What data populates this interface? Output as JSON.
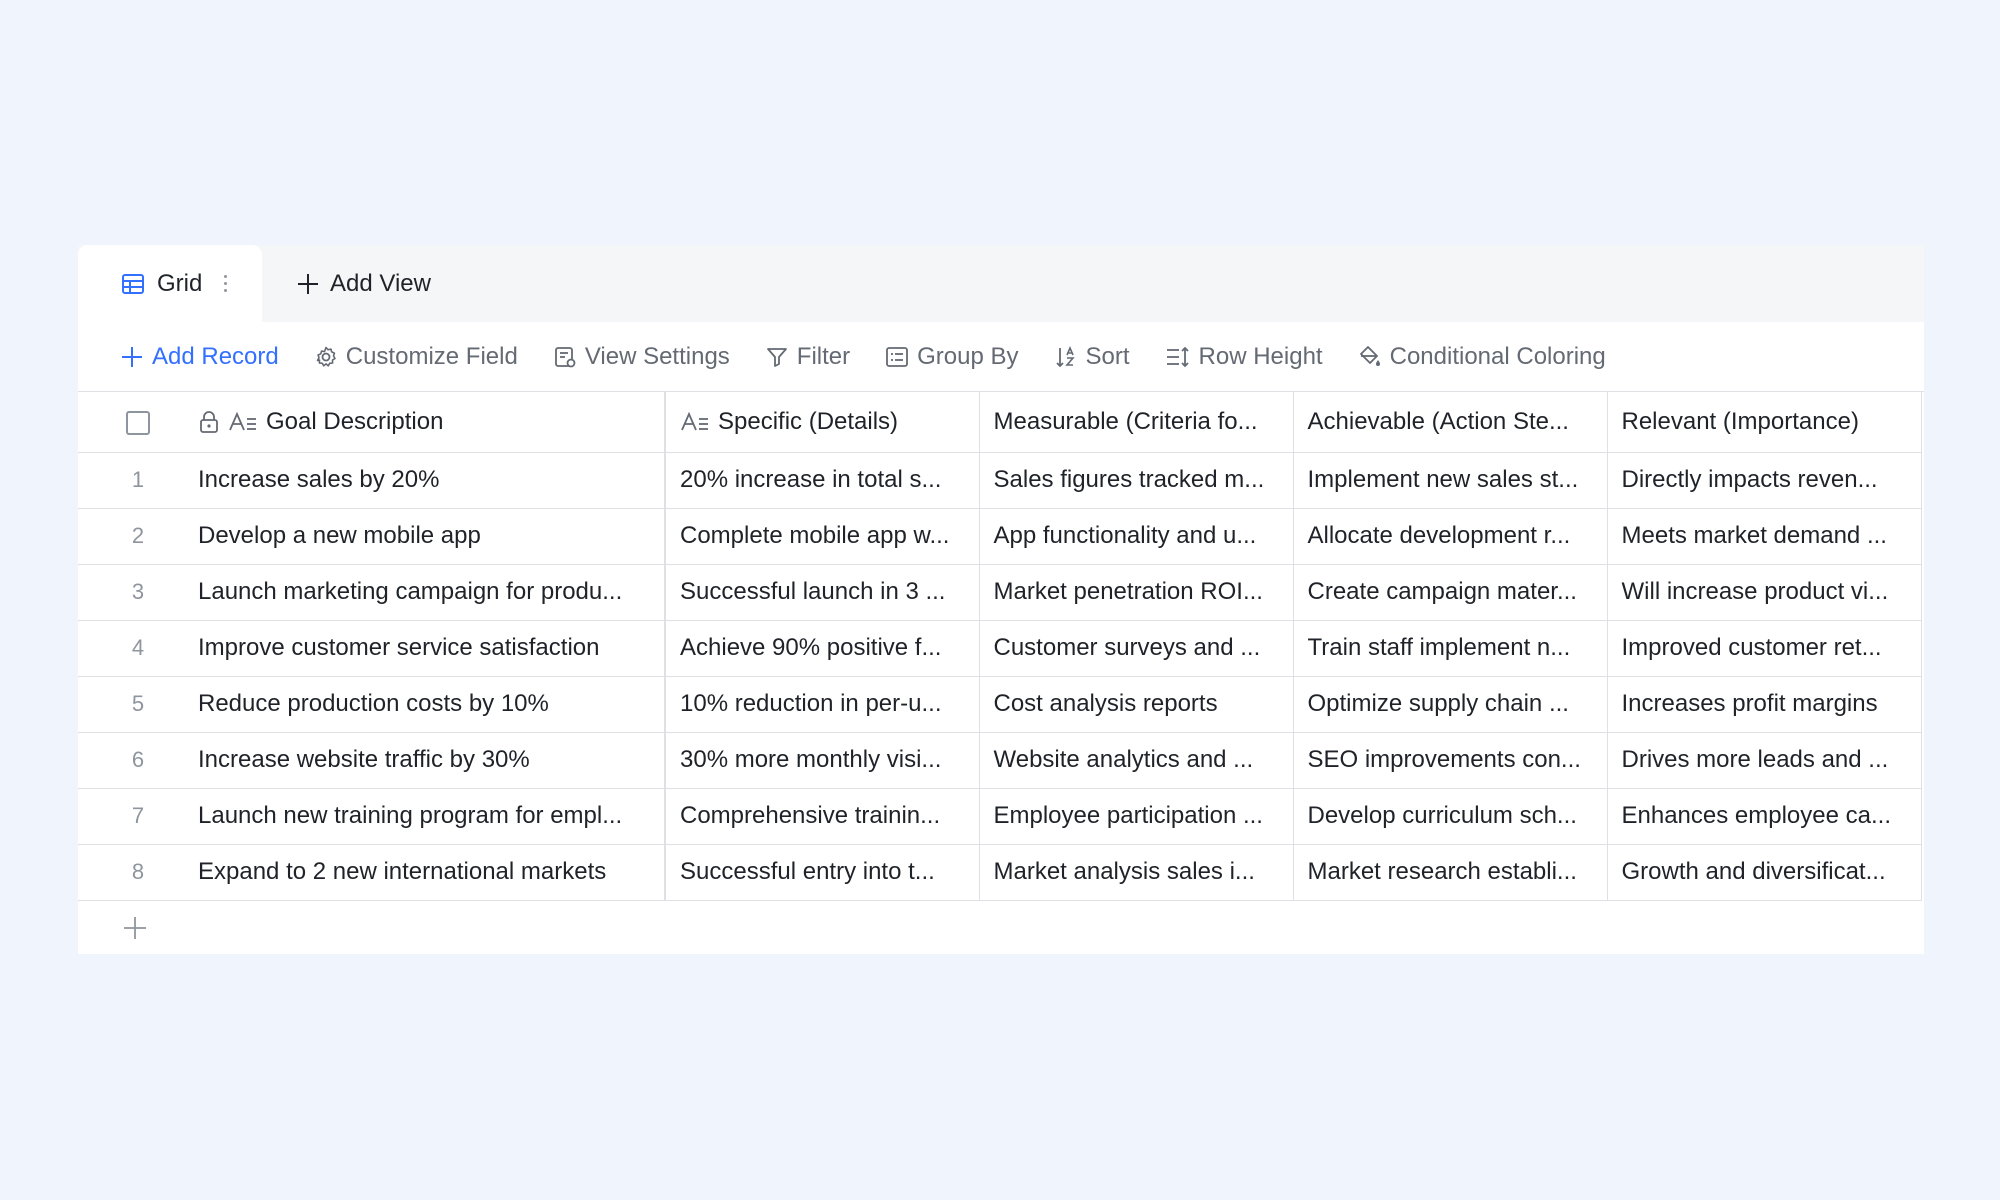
{
  "tabs": {
    "grid_label": "Grid",
    "add_view_label": "Add View"
  },
  "toolbar": {
    "add_record": "Add Record",
    "customize_field": "Customize Field",
    "view_settings": "View Settings",
    "filter": "Filter",
    "group_by": "Group By",
    "sort": "Sort",
    "row_height": "Row Height",
    "conditional_coloring": "Conditional Coloring"
  },
  "columns": [
    "Goal Description",
    "Specific (Details)",
    "Measurable (Criteria fo...",
    "Achievable (Action Ste...",
    "Relevant (Importance)"
  ],
  "rows": [
    {
      "n": "1",
      "cells": [
        "Increase sales by 20%",
        "20% increase in total s...",
        "Sales figures tracked m...",
        "Implement new sales st...",
        "Directly impacts reven..."
      ]
    },
    {
      "n": "2",
      "cells": [
        "Develop a new mobile app",
        "Complete mobile app w...",
        "App functionality and u...",
        "Allocate development r...",
        "Meets market demand ..."
      ]
    },
    {
      "n": "3",
      "cells": [
        "Launch marketing campaign for produ...",
        "Successful launch in 3 ...",
        "Market penetration ROI...",
        "Create campaign mater...",
        "Will increase product vi..."
      ]
    },
    {
      "n": "4",
      "cells": [
        "Improve customer service satisfaction",
        "Achieve 90% positive f...",
        "Customer surveys and ...",
        "Train staff implement n...",
        "Improved customer ret..."
      ]
    },
    {
      "n": "5",
      "cells": [
        "Reduce production costs by 10%",
        "10% reduction in per-u...",
        "Cost analysis reports",
        "Optimize supply chain ...",
        "Increases profit margins"
      ]
    },
    {
      "n": "6",
      "cells": [
        "Increase website traffic by 30%",
        "30% more monthly visi...",
        "Website analytics and ...",
        "SEO improvements con...",
        "Drives more leads and ..."
      ]
    },
    {
      "n": "7",
      "cells": [
        "Launch new training program for empl...",
        "Comprehensive trainin...",
        "Employee participation ...",
        "Develop curriculum sch...",
        "Enhances employee ca..."
      ]
    },
    {
      "n": "8",
      "cells": [
        "Expand to 2 new international markets",
        "Successful entry into t...",
        "Market analysis sales i...",
        "Market research establi...",
        "Growth and diversificat..."
      ]
    }
  ],
  "colors": {
    "background": "#eff4fd",
    "accent": "#3370ff",
    "muted_text": "#646a73",
    "border": "#dee0e3"
  }
}
